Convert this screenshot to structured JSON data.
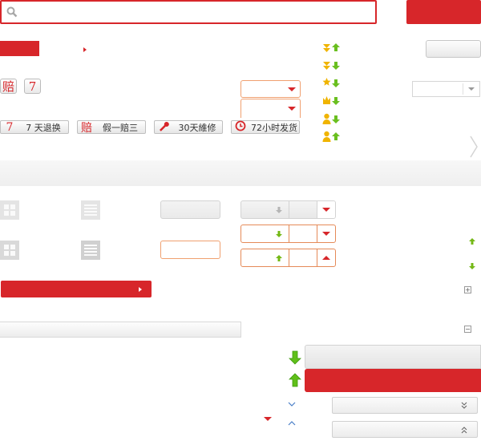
{
  "search": {
    "placeholder": ""
  },
  "service_badges": {
    "pay": "赔",
    "seven": "7"
  },
  "services": [
    {
      "icon": "7",
      "label": "7 天退换"
    },
    {
      "icon": "赔",
      "label": "假一赔三"
    },
    {
      "icon": "🔧",
      "label": "30天維修"
    },
    {
      "icon": "⏱",
      "label": "72小时发货"
    }
  ],
  "level_icons": [
    "diamond-up-icon",
    "diamond-down-icon",
    "star-down-icon",
    "crown-down-icon",
    "user-down-icon",
    "user-up-icon"
  ],
  "icons": {
    "search": "🔍",
    "chevron_right": "〉",
    "arrow_up": "▲",
    "arrow_down": "▼",
    "plus": "+",
    "minus": "−",
    "chevron_down_small": "∨",
    "chevron_up_small": "∧",
    "double_chevron_down": "»",
    "double_chevron_up": "«"
  },
  "colors": {
    "accent": "#d7262a",
    "orange_border": "#f0a070",
    "green_arrow": "#6abf1f",
    "gold": "#f0b400"
  }
}
